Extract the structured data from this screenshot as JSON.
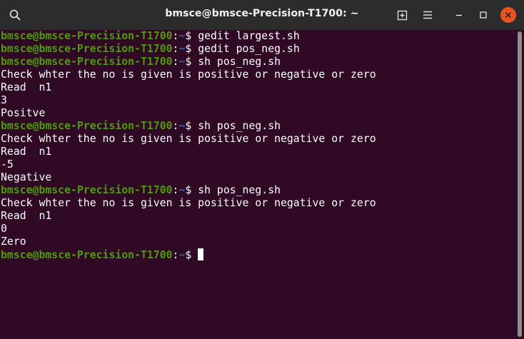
{
  "window": {
    "title": "bmsce@bmsce-Precision-T1700: ~"
  },
  "titlebar_icons": [
    "search-icon",
    "new-tab-icon",
    "hamburger-menu-icon",
    "minimize-icon",
    "maximize-icon",
    "close-icon"
  ],
  "colors": {
    "terminal_bg": "#300a24",
    "titlebar_bg": "#2c2c2c",
    "user_host": "#4e9a06",
    "path": "#3465a4",
    "close_button": "#e95420"
  },
  "prompt": {
    "user_host": "bmsce@bmsce-Precision-T1700",
    "colon": ":",
    "path": "~",
    "symbol": "$ "
  },
  "lines": [
    {
      "type": "prompt",
      "command": "gedit largest.sh"
    },
    {
      "type": "prompt",
      "command": "gedit pos_neg.sh"
    },
    {
      "type": "prompt",
      "command": "sh pos_neg.sh"
    },
    {
      "type": "output",
      "text": "Check whter the no is given is positive or negative or zero"
    },
    {
      "type": "output",
      "text": "Read  n1"
    },
    {
      "type": "output",
      "text": "3"
    },
    {
      "type": "output",
      "text": "Positve"
    },
    {
      "type": "prompt",
      "command": "sh pos_neg.sh"
    },
    {
      "type": "output",
      "text": "Check whter the no is given is positive or negative or zero"
    },
    {
      "type": "output",
      "text": "Read  n1"
    },
    {
      "type": "output",
      "text": "-5"
    },
    {
      "type": "output",
      "text": "Negative"
    },
    {
      "type": "prompt",
      "command": "sh pos_neg.sh"
    },
    {
      "type": "output",
      "text": "Check whter the no is given is positive or negative or zero"
    },
    {
      "type": "output",
      "text": "Read  n1"
    },
    {
      "type": "output",
      "text": "0"
    },
    {
      "type": "output",
      "text": "Zero"
    },
    {
      "type": "prompt",
      "command": "",
      "cursor": true
    }
  ]
}
